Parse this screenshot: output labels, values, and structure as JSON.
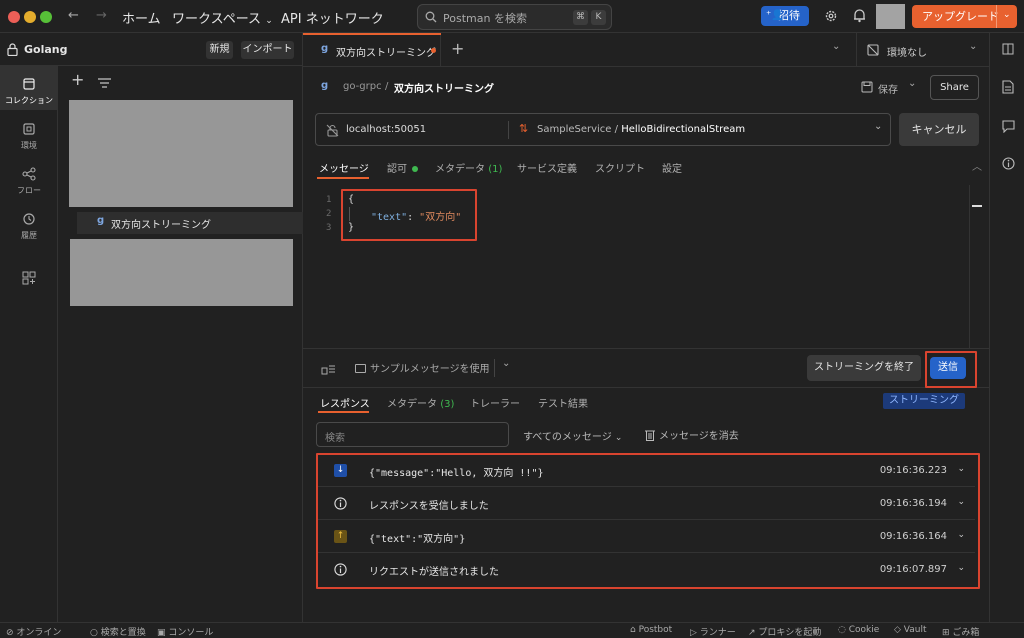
{
  "titlebar": {
    "home": "ホーム",
    "workspaces": "ワークスペース",
    "api_network": "API ネットワーク",
    "search_placeholder": "Postman を検索",
    "kbd_cmd": "⌘",
    "kbd_k": "K",
    "invite": "招待",
    "upgrade": "アップグレード"
  },
  "workspace": {
    "name": "Golang",
    "new": "新規",
    "import": "インポート"
  },
  "rail": [
    {
      "label": "コレクション",
      "icon": "collection-icon"
    },
    {
      "label": "環境",
      "icon": "environment-icon"
    },
    {
      "label": "フロー",
      "icon": "flows-icon"
    },
    {
      "label": "履歴",
      "icon": "history-icon"
    }
  ],
  "sidebar": {
    "selected_item": "双方向ストリーミング"
  },
  "tab": {
    "label": "双方向ストリーミング",
    "environment": "環境なし"
  },
  "request": {
    "breadcrumb_parent": "go-grpc",
    "breadcrumb_sep": "/",
    "title": "双方向ストリーミング",
    "save": "保存",
    "share": "Share",
    "url": "localhost:50051",
    "service": "SampleService",
    "method_sep": "/",
    "method": "HelloBidirectionalStream",
    "cancel": "キャンセル",
    "tabs": [
      {
        "label": "メッセージ",
        "active": true
      },
      {
        "label": "認可",
        "active": false
      },
      {
        "label": "メタデータ",
        "count": "(1)",
        "active": false
      },
      {
        "label": "サービス定義",
        "active": false
      },
      {
        "label": "スクリプト",
        "active": false
      },
      {
        "label": "設定",
        "active": false
      }
    ],
    "code_lines": [
      {
        "num": "1",
        "text": "{"
      },
      {
        "num": "2",
        "key": "\"text\"",
        "colon": ": ",
        "value": "\"双方向\""
      },
      {
        "num": "3",
        "text": "}"
      }
    ],
    "use_example": "サンプルメッセージを使用",
    "end_stream": "ストリーミングを終了",
    "send": "送信"
  },
  "response": {
    "tabs": [
      {
        "label": "レスポンス",
        "active": true
      },
      {
        "label": "メタデータ",
        "count": "(3)",
        "active": false
      },
      {
        "label": "トレーラー",
        "active": false
      },
      {
        "label": "テスト結果",
        "active": false
      }
    ],
    "streaming_badge": "ストリーミング",
    "search_placeholder": "検索",
    "filter": "すべてのメッセージ",
    "clear": "メッセージを消去",
    "rows": [
      {
        "icon": "arrow-down-icon",
        "text": "{\"message\":\"Hello, 双方向 !!\"}",
        "time": "09:16:36.223",
        "mono": true
      },
      {
        "icon": "info-icon",
        "text": "レスポンスを受信しました",
        "time": "09:16:36.194",
        "mono": false
      },
      {
        "icon": "arrow-up-icon",
        "text": "{\"text\":\"双方向\"}",
        "time": "09:16:36.164",
        "mono": true
      },
      {
        "icon": "info-icon",
        "text": "リクエストが送信されました",
        "time": "09:16:07.897",
        "mono": false
      }
    ]
  },
  "statusbar": {
    "online": "オンライン",
    "find": "検索と置換",
    "console": "コンソール",
    "postbot": "Postbot",
    "runner": "ランナー",
    "proxy": "プロキシを起動",
    "cookie": "Cookie",
    "vault": "Vault",
    "trash": "ごみ箱"
  },
  "colors": {
    "accent": "#e8612f",
    "blue": "#2563c9",
    "green": "#3fb950",
    "highlight": "#d9442f"
  }
}
